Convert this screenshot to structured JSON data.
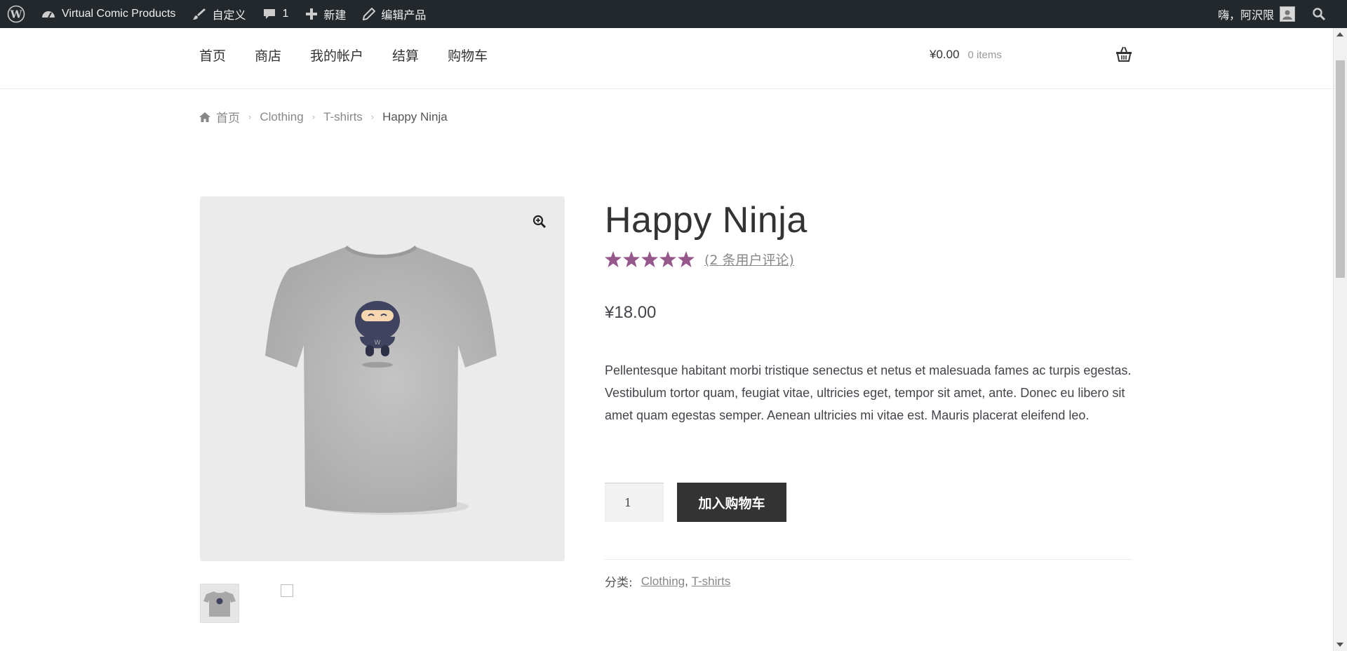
{
  "adminbar": {
    "site_name": "Virtual Comic Products",
    "customize": "自定义",
    "comments_count": "1",
    "new": "新建",
    "edit_product": "编辑产品",
    "greeting": "嗨，阿沢限"
  },
  "nav": {
    "items": [
      "首页",
      "商店",
      "我的帐户",
      "结算",
      "购物车"
    ]
  },
  "cart": {
    "amount": "¥0.00",
    "count": "0 items"
  },
  "breadcrumb": {
    "home": "首页",
    "items": [
      "Clothing",
      "T-shirts"
    ],
    "current": "Happy Ninja"
  },
  "product": {
    "title": "Happy Ninja",
    "rating": 5,
    "review_link": "(2 条用户评论)",
    "price": "¥18.00",
    "description": "Pellentesque habitant morbi tristique senectus et netus et malesuada fames ac turpis egestas. Vestibulum tortor quam, feugiat vitae, ultricies eget, tempor sit amet, ante. Donec eu libero sit amet quam egestas semper. Aenean ultricies mi vitae est. Mauris placerat eleifend leo.",
    "quantity": "1",
    "add_to_cart": "加入购物车",
    "categories_label": "分类:",
    "categories": [
      "Clothing",
      "T-shirts"
    ]
  },
  "colors": {
    "adminbar_bg": "#23282d",
    "star": "#96588a",
    "button_bg": "#333333",
    "gallery_bg": "#ebebeb"
  }
}
